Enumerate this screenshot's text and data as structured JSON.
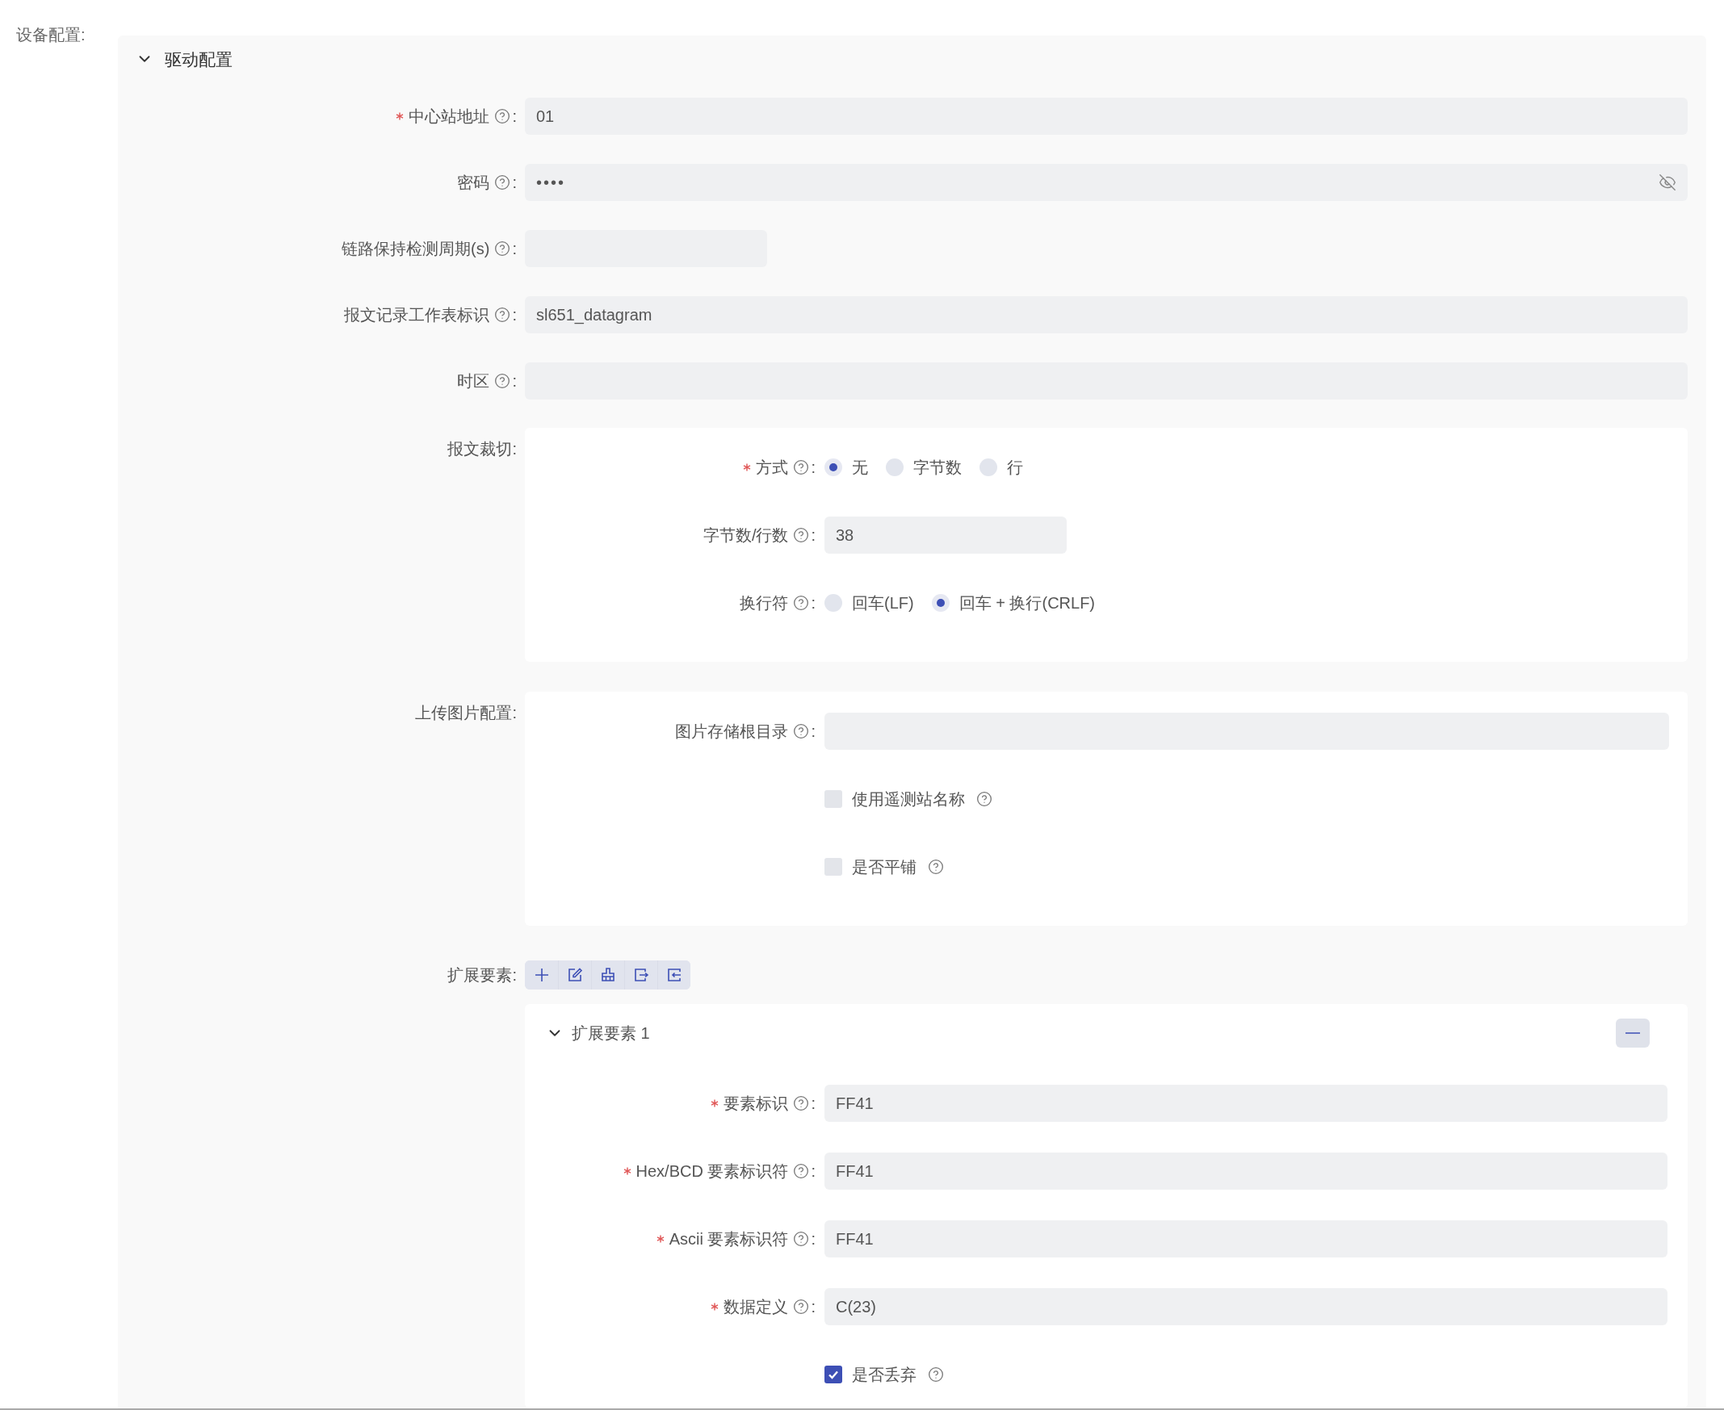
{
  "form_label": "设备配置:",
  "panel": {
    "title": "驱动配置",
    "expanded": true,
    "fields": [
      {
        "kind": "input",
        "label": "中心站地址",
        "required": true,
        "help": true,
        "colon": ":",
        "value": "01"
      },
      {
        "kind": "password",
        "label": "密码",
        "required": false,
        "help": true,
        "colon": ":",
        "value": "••••"
      },
      {
        "kind": "short_input",
        "label": "链路保持检测周期(s)",
        "required": false,
        "help": true,
        "colon": ":"
      },
      {
        "kind": "input",
        "label": "报文记录工作表标识",
        "required": false,
        "help": true,
        "colon": ":",
        "value": "sl651_datagram"
      },
      {
        "kind": "input",
        "label": "时区",
        "required": false,
        "help": true,
        "colon": ":"
      },
      {
        "kind": "group",
        "label": "报文裁切",
        "colon": ":",
        "fields": [
          {
            "kind": "radio",
            "label": "方式",
            "required": true,
            "help": true,
            "colon": ":",
            "options": [
              {
                "label": "无",
                "selected": true
              },
              {
                "label": "字节数",
                "selected": false
              },
              {
                "label": "行",
                "selected": false
              }
            ]
          },
          {
            "kind": "short_input",
            "label": "字节数/行数",
            "required": false,
            "help": true,
            "colon": ":",
            "value": "38"
          },
          {
            "kind": "radio",
            "label": "换行符",
            "required": false,
            "help": true,
            "colon": ":",
            "options": [
              {
                "label": "回车(LF)",
                "selected": false
              },
              {
                "label": "回车 + 换行(CRLF)",
                "selected": true
              }
            ]
          }
        ]
      },
      {
        "kind": "group",
        "label": "上传图片配置",
        "colon": ":",
        "fields": [
          {
            "kind": "input",
            "label": "图片存储根目录",
            "required": false,
            "help": true,
            "colon": ":"
          },
          {
            "kind": "checkbox",
            "label": "使用遥测站名称",
            "help": true,
            "checked": false
          },
          {
            "kind": "checkbox",
            "label": "是否平铺",
            "help": true,
            "checked": false
          }
        ]
      },
      {
        "kind": "list",
        "label": "扩展要素",
        "colon": ":",
        "toolbar": [
          {
            "kind": "add"
          },
          {
            "kind": "edit"
          },
          {
            "kind": "clear"
          },
          {
            "kind": "export"
          },
          {
            "kind": "import"
          }
        ],
        "items": [
          {
            "title": "扩展要素 1",
            "expanded": true,
            "fields": [
              {
                "kind": "input",
                "label": "要素标识",
                "required": true,
                "help": true,
                "colon": ":",
                "value": "FF41"
              },
              {
                "kind": "input",
                "label": "Hex/BCD 要素标识符",
                "required": true,
                "help": true,
                "colon": ":",
                "value": "FF41"
              },
              {
                "kind": "input",
                "label": "Ascii 要素标识符",
                "required": true,
                "help": true,
                "colon": ":",
                "value": "FF41"
              },
              {
                "kind": "input",
                "label": "数据定义",
                "required": true,
                "help": true,
                "colon": ":",
                "value": "C(23)"
              },
              {
                "kind": "checkbox",
                "label": "是否丢弃",
                "help": true,
                "checked": true
              }
            ]
          }
        ]
      }
    ]
  }
}
